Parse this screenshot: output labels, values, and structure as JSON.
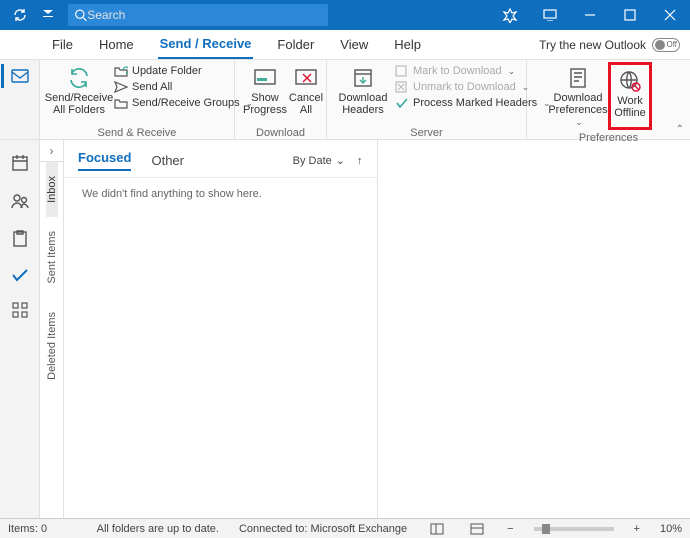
{
  "titlebar": {
    "search_placeholder": "Search"
  },
  "menu": {
    "file": "File",
    "home": "Home",
    "send_receive": "Send / Receive",
    "folder": "Folder",
    "view": "View",
    "help": "Help",
    "try_new": "Try the new Outlook",
    "toggle_off": "Off"
  },
  "ribbon": {
    "sr_group": "Send & Receive",
    "sr_all": "Send/Receive All Folders",
    "update_folder": "Update Folder",
    "send_all": "Send All",
    "sr_groups": "Send/Receive Groups",
    "dl_group": "Download",
    "show_progress": "Show Progress",
    "cancel_all": "Cancel All",
    "server_group": "Server",
    "dl_headers": "Download Headers",
    "mark_dl": "Mark to Download",
    "unmark_dl": "Unmark to Download",
    "process_headers": "Process Marked Headers",
    "pref_group": "Preferences",
    "dl_prefs": "Download Preferences",
    "work_offline": "Work Offline"
  },
  "folders": {
    "inbox": "Inbox",
    "sent": "Sent Items",
    "deleted": "Deleted Items"
  },
  "list": {
    "focused": "Focused",
    "other": "Other",
    "by_date": "By Date",
    "empty": "We didn't find anything to show here."
  },
  "status": {
    "items": "Items: 0",
    "uptodate": "All folders are up to date.",
    "connected": "Connected to: Microsoft Exchange",
    "zoom": "10%"
  }
}
